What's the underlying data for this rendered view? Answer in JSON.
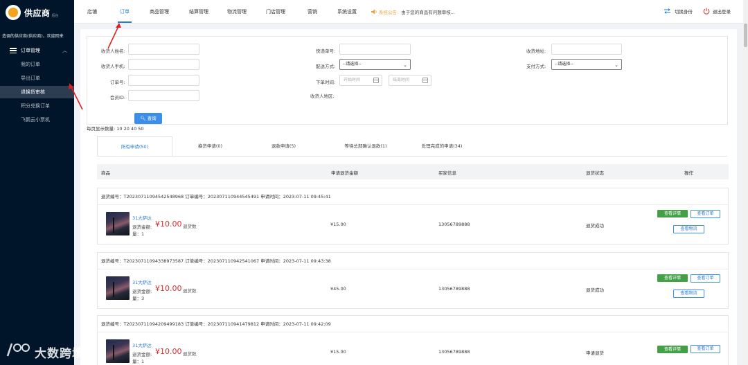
{
  "brand": {
    "name": "供应商",
    "sub": "后台"
  },
  "sidebar": {
    "welcome": "造调的供应商(供应商)，欢迎回来",
    "group": "订单管理",
    "items": [
      {
        "label": "我的订单"
      },
      {
        "label": "导出订单"
      },
      {
        "label": "退换货审核"
      },
      {
        "label": "积分兑换订单"
      },
      {
        "label": "飞鹅云小票机"
      }
    ]
  },
  "watermark": "大数跨境",
  "nav": {
    "items": [
      {
        "label": "店铺"
      },
      {
        "label": "订单"
      },
      {
        "label": "商品管理"
      },
      {
        "label": "结算管理"
      },
      {
        "label": "物流管理"
      },
      {
        "label": "门店管理"
      },
      {
        "label": "营销"
      },
      {
        "label": "系统设置"
      }
    ],
    "notice_label": "系统公告:",
    "notice_text": "由于您的商品有问题审核...",
    "switch_identity": "切换身份",
    "logout": "退出登录"
  },
  "filters": {
    "receiver_name": "收货人姓名:",
    "receiver_phone": "收货人手机:",
    "order_no": "订单号:",
    "member_id": "会员ID:",
    "express_no": "快递单号:",
    "delivery_method": "配送方式:",
    "delivery_value": "--请选择--",
    "order_time": "下单时间:",
    "start_time": "开始时间",
    "end_time": "结束时间",
    "receiver_region": "收货人地区:",
    "receiver_address": "收货地址:",
    "pay_method": "支付方式:",
    "pay_value": "--请选择--",
    "query_button": "查询"
  },
  "page_size": "每页显示数量: 10 20 40 50",
  "tabs": [
    {
      "label": "所有申请(50)"
    },
    {
      "label": "换货申请(0)"
    },
    {
      "label": "退款申请(5)"
    },
    {
      "label": "等待总部确认退款(1)"
    },
    {
      "label": "处理完成的申请(34)"
    }
  ],
  "table_headers": {
    "product": "商品",
    "refund_amount": "申请退货金额",
    "buyer": "买家信息",
    "status": "退货状态",
    "actions": "操作"
  },
  "orders": [
    {
      "header": "退货编号：T20230711094542548968  订单编号：202307110944545491    申请时间：2023-07-11 09:45:41",
      "product_name": "31大萨达",
      "refund_label": "退货金额:",
      "amount": "¥10.00",
      "qty_label": "退货数",
      "qty": "量：1",
      "price": "¥15.00",
      "buyer": "13056789888",
      "status": "退货成功",
      "btn_detail": "查看详情",
      "btn_order": "查看订单",
      "btn_logistics": "查看物流"
    },
    {
      "header": "退货编号：T20230711094338973587  订单编号：202307110942541067    申请时间：2023-07-11 09:43:38",
      "product_name": "31大萨达",
      "refund_label": "退货金额:",
      "amount": "¥10.00",
      "qty_label": "退货数",
      "qty": "量：3",
      "price": "¥45.00",
      "buyer": "13056789888",
      "status": "退货成功",
      "btn_detail": "查看详情",
      "btn_order": "查看订单",
      "btn_logistics": "查看物流"
    },
    {
      "header": "退货编号：T20230711094209499183  订单编号：202307110941479812    申请时间：2023-07-11 09:42:09",
      "product_name": "31大萨达",
      "refund_label": "退货金额:",
      "amount": "¥10.00",
      "qty_label": "退货数",
      "qty": "量：1",
      "price": "¥15.00",
      "buyer": "13056789888",
      "status": "申请退货",
      "btn_detail": "查看详情",
      "btn_order": "查看订单"
    }
  ]
}
